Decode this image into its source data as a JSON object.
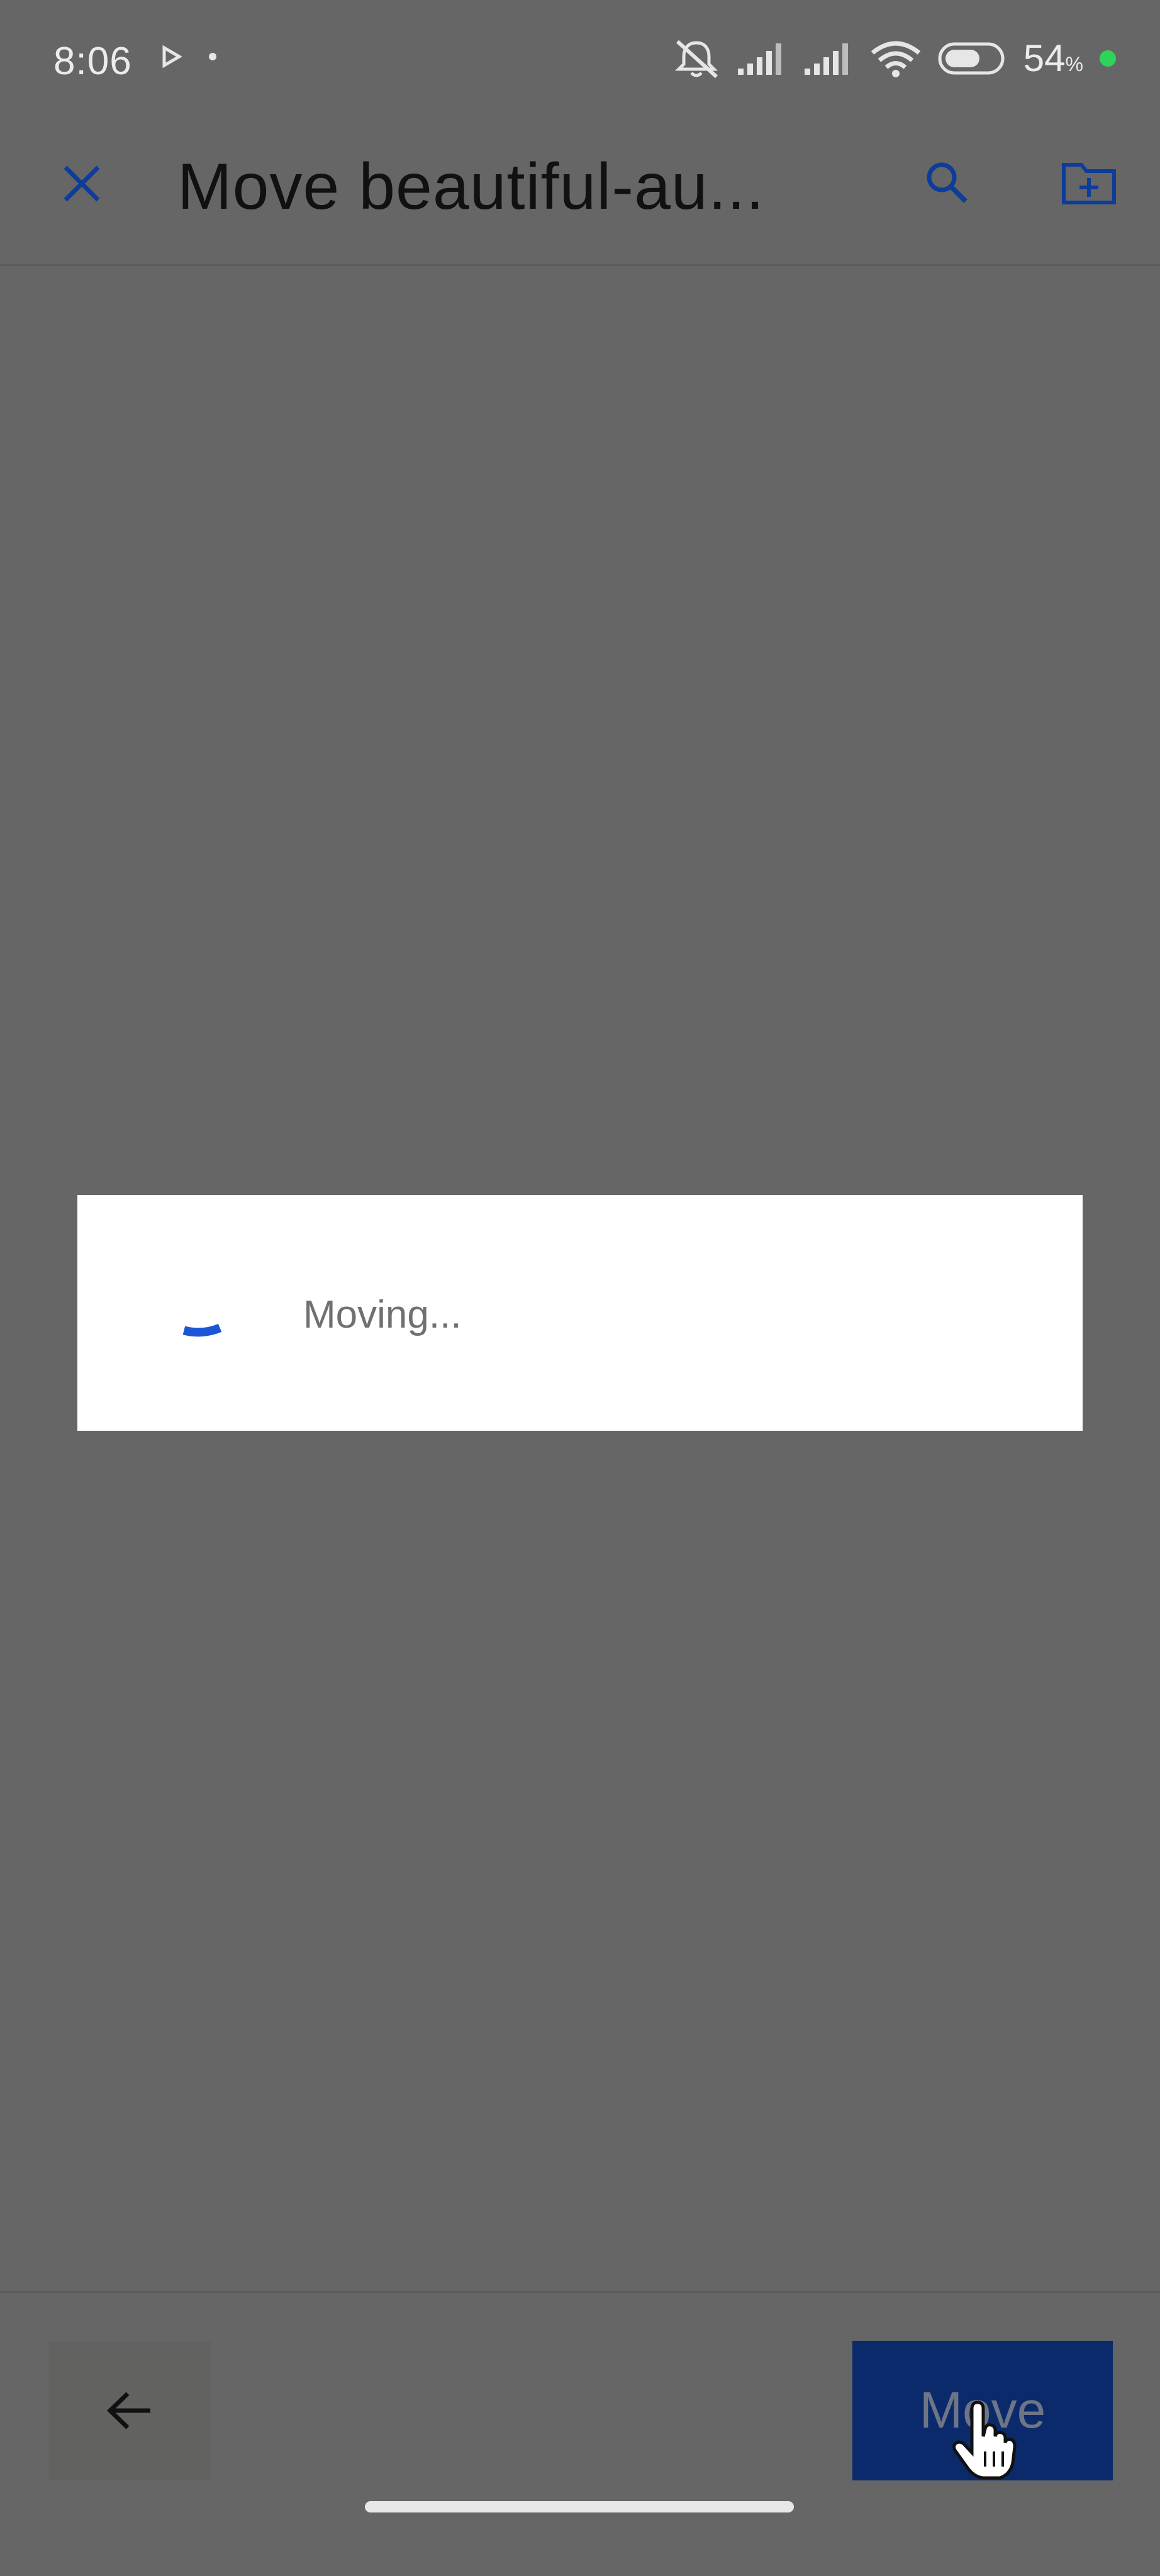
{
  "status_bar": {
    "time": "8:06",
    "battery_percent": "54",
    "battery_unit": "%",
    "icons": [
      "play-icon",
      "notification-dot-icon",
      "mute-icon",
      "signal-icon",
      "signal-icon",
      "wifi-icon",
      "battery-icon",
      "charging-dot-icon"
    ]
  },
  "app_bar": {
    "title": "Move beautiful-au...",
    "icons": [
      "close-icon",
      "search-icon",
      "new-folder-icon"
    ]
  },
  "dialog": {
    "message": "Moving..."
  },
  "bottom_bar": {
    "move_label": "Move",
    "icons": [
      "arrow-left-icon"
    ]
  },
  "colors": {
    "scrim": "#666666",
    "accent": "#1a56d6",
    "primary_button": "#0b2a6b",
    "dialog_bg": "#ffffff"
  }
}
